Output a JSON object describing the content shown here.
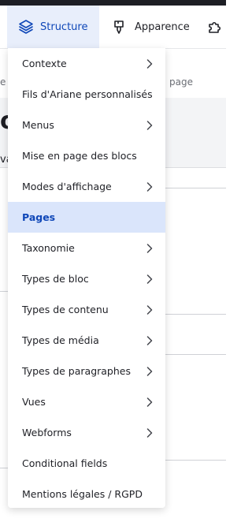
{
  "toolbar": {
    "structure_label": "Structure",
    "apparence_label": "Apparence"
  },
  "background": {
    "e_fragment": "e",
    "page_fragment": "page",
    "heading_fragment": "o",
    "va_fragment": "va"
  },
  "menu": {
    "items": [
      {
        "label": "Contexte",
        "submenu": true
      },
      {
        "label": "Fils d'Ariane personnalisés",
        "submenu": false
      },
      {
        "label": "Menus",
        "submenu": true
      },
      {
        "label": "Mise en page des blocs",
        "submenu": false
      },
      {
        "label": "Modes d'affichage",
        "submenu": true
      },
      {
        "label": "Pages",
        "submenu": false,
        "active": true
      },
      {
        "label": "Taxonomie",
        "submenu": true
      },
      {
        "label": "Types de bloc",
        "submenu": true
      },
      {
        "label": "Types de contenu",
        "submenu": true
      },
      {
        "label": "Types de média",
        "submenu": true
      },
      {
        "label": "Types de paragraphes",
        "submenu": true
      },
      {
        "label": "Vues",
        "submenu": true
      },
      {
        "label": "Webforms",
        "submenu": true
      },
      {
        "label": "Conditional fields",
        "submenu": false
      },
      {
        "label": "Mentions légales / RGPD",
        "submenu": false
      }
    ]
  },
  "colors": {
    "accent": "#0f47b8",
    "active_bg": "#dae5fb",
    "topbar": "#1d1e24"
  }
}
